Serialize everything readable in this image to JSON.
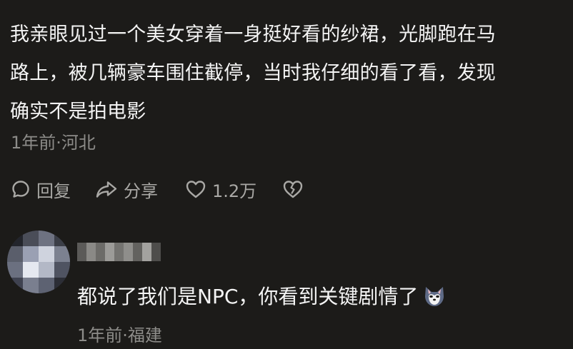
{
  "main_comment": {
    "text_line_1": "我亲眼见过一个美女穿着一身挺好看的纱裙，光脚跑在马",
    "text_line_2": "路上，被几辆豪车围住截停，当时我仔细的看了看，发现",
    "text_line_3": "确实不是拍电影",
    "meta": "1年前·河北"
  },
  "actions": {
    "reply_label": "回复",
    "share_label": "分享",
    "like_count": "1.2万"
  },
  "reply": {
    "text": "都说了我们是NPC，你看到关键剧情了",
    "emoji": "wolf-face-emoji",
    "meta": "1年前·福建"
  },
  "colors": {
    "background": "#1c1b19",
    "text_primary": "#f4f4f4",
    "text_secondary": "#8d8c89",
    "icon": "#a9a8a5"
  }
}
